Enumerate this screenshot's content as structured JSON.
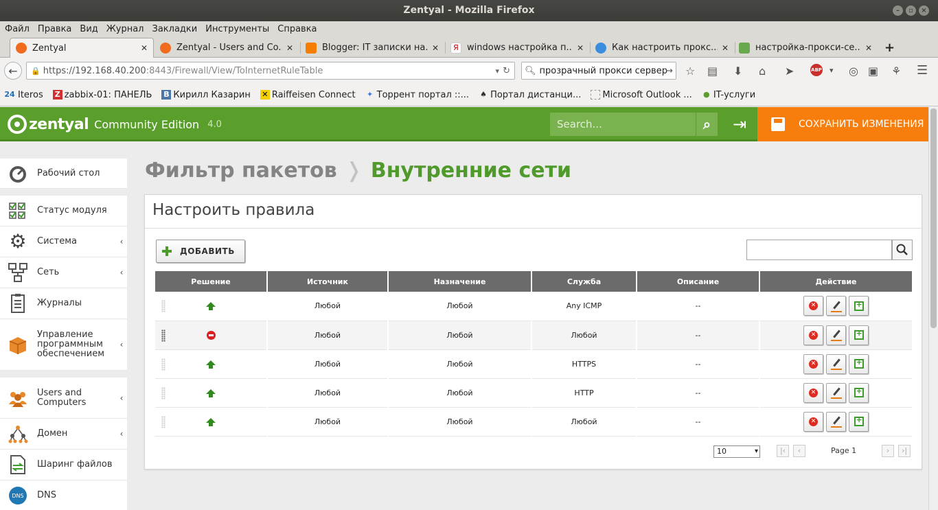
{
  "window": {
    "title": "Zentyal - Mozilla Firefox"
  },
  "menu": [
    "Файл",
    "Правка",
    "Вид",
    "Журнал",
    "Закладки",
    "Инструменты",
    "Справка"
  ],
  "tabs": [
    {
      "label": "Zentyal",
      "icon_color": "#f06b1d"
    },
    {
      "label": "Zentyal - Users and Co...",
      "icon_color": "#f06b1d"
    },
    {
      "label": "Blogger: IT записки на...",
      "icon_color": "#f57d00"
    },
    {
      "label": "windows настройка п...",
      "icon_color": "#cc0000"
    },
    {
      "label": "Как настроить прокс...",
      "icon_color": "#3b8ede"
    },
    {
      "label": "настройка-прокси-се...",
      "icon_color": "#6aa84f"
    }
  ],
  "nav": {
    "url_host": "https://192.168.40.200",
    "url_rest": ":8443/Firewall/View/ToInternetRuleTable",
    "search_value": "прозрачный прокси сервер"
  },
  "bookmarks": [
    {
      "label": "Iteros",
      "icon_text": "24",
      "icon_color": "#1f6fbf"
    },
    {
      "label": "zabbix-01: ПАНЕЛЬ",
      "icon_text": "Z",
      "icon_color": "#d32f2f"
    },
    {
      "label": "Кирилл Казарин",
      "icon_text": "B",
      "icon_color": "#4a76a8"
    },
    {
      "label": "Raiffeisen Connect",
      "icon_text": "✕",
      "icon_color": "#f4d000"
    },
    {
      "label": "Торрент портал ::...",
      "icon_text": "✦",
      "icon_color": "#3a7bd5"
    },
    {
      "label": "Портал дистанци...",
      "icon_text": "♠",
      "icon_color": "#333333"
    },
    {
      "label": "Microsoft Outlook ...",
      "icon_text": "",
      "icon_color": "#bbbbbb"
    },
    {
      "label": "IT-услуги",
      "icon_text": "●",
      "icon_color": "#5a9e2b"
    }
  ],
  "header": {
    "brand": "zentyal",
    "edition": "Community Edition",
    "version": "4.0",
    "search_placeholder": "Search...",
    "save_label": "СОХРАНИТЬ ИЗМЕНЕНИЯ"
  },
  "sidebar": [
    {
      "label": "Рабочий стол",
      "icon": "dashboard-icon",
      "arrow": ""
    },
    {
      "label": "Статус модуля",
      "icon": "module-status-icon",
      "arrow": ""
    },
    {
      "label": "Система",
      "icon": "gear-icon",
      "arrow": "‹"
    },
    {
      "label": "Сеть",
      "icon": "network-icon",
      "arrow": "‹"
    },
    {
      "label": "Журналы",
      "icon": "clipboard-icon",
      "arrow": ""
    },
    {
      "label": "Управление программным обеспечением",
      "icon": "package-icon",
      "arrow": "‹"
    },
    {
      "label": "Users and Computers",
      "icon": "users-icon",
      "arrow": "‹"
    },
    {
      "label": "Домен",
      "icon": "domain-icon",
      "arrow": "‹"
    },
    {
      "label": "Шаринг файлов",
      "icon": "file-sharing-icon",
      "arrow": ""
    },
    {
      "label": "DNS",
      "icon": "dns-icon",
      "arrow": ""
    }
  ],
  "breadcrumb": {
    "parent": "Фильтр пакетов",
    "separator": "❭",
    "current": "Внутренние сети"
  },
  "panel": {
    "title": "Настроить правила",
    "add_label": "ДОБАВИТЬ",
    "columns": [
      "Решение",
      "Источник",
      "Назначение",
      "Служба",
      "Описание",
      "Действие"
    ],
    "rows": [
      {
        "decision": "accept",
        "source": "Любой",
        "destination": "Любой",
        "service": "Any ICMP",
        "description": "--"
      },
      {
        "decision": "deny",
        "source": "Любой",
        "destination": "Любой",
        "service": "Любой",
        "description": "--"
      },
      {
        "decision": "accept",
        "source": "Любой",
        "destination": "Любой",
        "service": "HTTPS",
        "description": "--"
      },
      {
        "decision": "accept",
        "source": "Любой",
        "destination": "Любой",
        "service": "HTTP",
        "description": "--"
      },
      {
        "decision": "accept",
        "source": "Любой",
        "destination": "Любой",
        "service": "Любой",
        "description": "--"
      }
    ],
    "page_size": "10",
    "page_label": "Page 1"
  }
}
